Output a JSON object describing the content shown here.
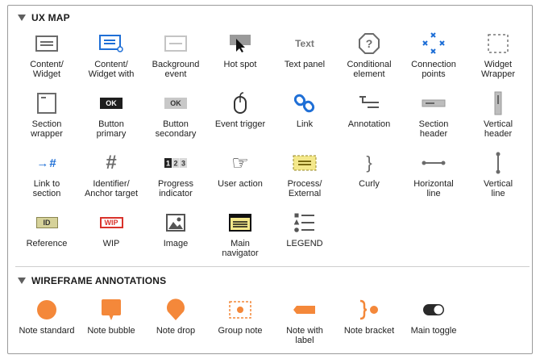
{
  "ux_map": {
    "title": "UX MAP",
    "items": [
      {
        "label": "Content/\nWidget",
        "icon": "content-widget-icon"
      },
      {
        "label": "Content/\nWidget with",
        "icon": "content-widget-with-icon"
      },
      {
        "label": "Background\nevent",
        "icon": "background-event-icon"
      },
      {
        "label": "Hot spot",
        "icon": "hot-spot-icon"
      },
      {
        "label": "Text panel",
        "icon": "text-panel-icon",
        "glyph": "Text"
      },
      {
        "label": "Conditional\nelement",
        "icon": "conditional-element-icon",
        "glyph": "?"
      },
      {
        "label": "Connection\npoints",
        "icon": "connection-points-icon"
      },
      {
        "label": "Widget\nWrapper",
        "icon": "widget-wrapper-icon"
      },
      {
        "label": "Section\nwrapper",
        "icon": "section-wrapper-icon"
      },
      {
        "label": "Button\nprimary",
        "icon": "button-primary-icon",
        "glyph": "OK"
      },
      {
        "label": "Button\nsecondary",
        "icon": "button-secondary-icon",
        "glyph": "OK"
      },
      {
        "label": "Event trigger",
        "icon": "mouse-icon"
      },
      {
        "label": "Link",
        "icon": "link-icon"
      },
      {
        "label": "Annotation",
        "icon": "annotation-icon"
      },
      {
        "label": "Section\nheader",
        "icon": "section-header-icon"
      },
      {
        "label": "Vertical\nheader",
        "icon": "vertical-header-icon"
      },
      {
        "label": "Link to\nsection",
        "icon": "link-to-section-icon",
        "glyph": "→#"
      },
      {
        "label": "Identifier/\nAnchor target",
        "icon": "hash-icon",
        "glyph": "#"
      },
      {
        "label": "Progress\nindicator",
        "icon": "progress-indicator-icon",
        "glyph": "123"
      },
      {
        "label": "User action",
        "icon": "pointing-hand-icon",
        "glyph": "☞"
      },
      {
        "label": "Process/\nExternal",
        "icon": "process-external-icon"
      },
      {
        "label": "Curly",
        "icon": "curly-brace-icon",
        "glyph": "}"
      },
      {
        "label": "Horizontal\nline",
        "icon": "horizontal-line-icon"
      },
      {
        "label": "Vertical\nline",
        "icon": "vertical-line-icon"
      },
      {
        "label": "Reference",
        "icon": "reference-icon",
        "glyph": "ID"
      },
      {
        "label": "WIP",
        "icon": "wip-icon",
        "glyph": "WIP"
      },
      {
        "label": "Image",
        "icon": "image-icon"
      },
      {
        "label": "Main\nnavigator",
        "icon": "main-navigator-icon"
      },
      {
        "label": "LEGEND",
        "icon": "legend-icon"
      }
    ]
  },
  "wireframe_annotations": {
    "title": "WIREFRAME ANNOTATIONS",
    "items": [
      {
        "label": "Note standard",
        "icon": "note-standard-icon"
      },
      {
        "label": "Note bubble",
        "icon": "note-bubble-icon"
      },
      {
        "label": "Note drop",
        "icon": "note-drop-icon"
      },
      {
        "label": "Group note",
        "icon": "group-note-icon"
      },
      {
        "label": "Note with\nlabel",
        "icon": "note-with-label-icon"
      },
      {
        "label": "Note bracket",
        "icon": "note-bracket-icon"
      },
      {
        "label": "Main toggle",
        "icon": "toggle-icon"
      }
    ]
  },
  "colors": {
    "blue": "#1f6fd6",
    "orange": "#f4883a",
    "gray_icon": "#6b6b6b",
    "yellow": "#f4e88b",
    "wip_red": "#d9322b"
  }
}
